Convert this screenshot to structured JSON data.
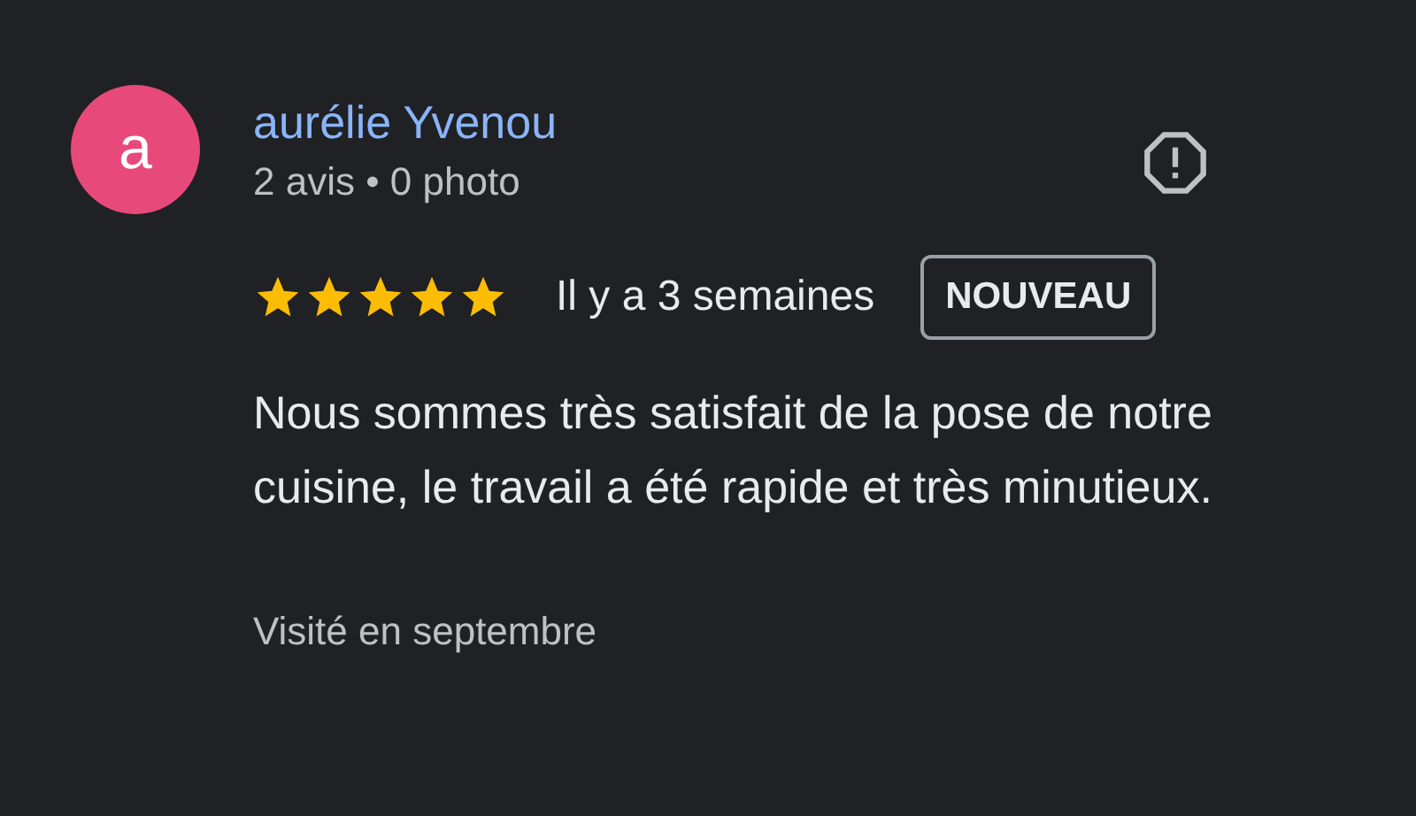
{
  "review": {
    "avatar_letter": "a",
    "author": "aurélie Yvenou",
    "author_stats": "2 avis • 0 photo",
    "stars": 5,
    "time": "Il y a 3 semaines",
    "badge": "NOUVEAU",
    "text": "Nous sommes très satisfait de la pose de notre cuisine, le travail a été rapide et très minutieux.",
    "visit": "Visité en septembre"
  }
}
